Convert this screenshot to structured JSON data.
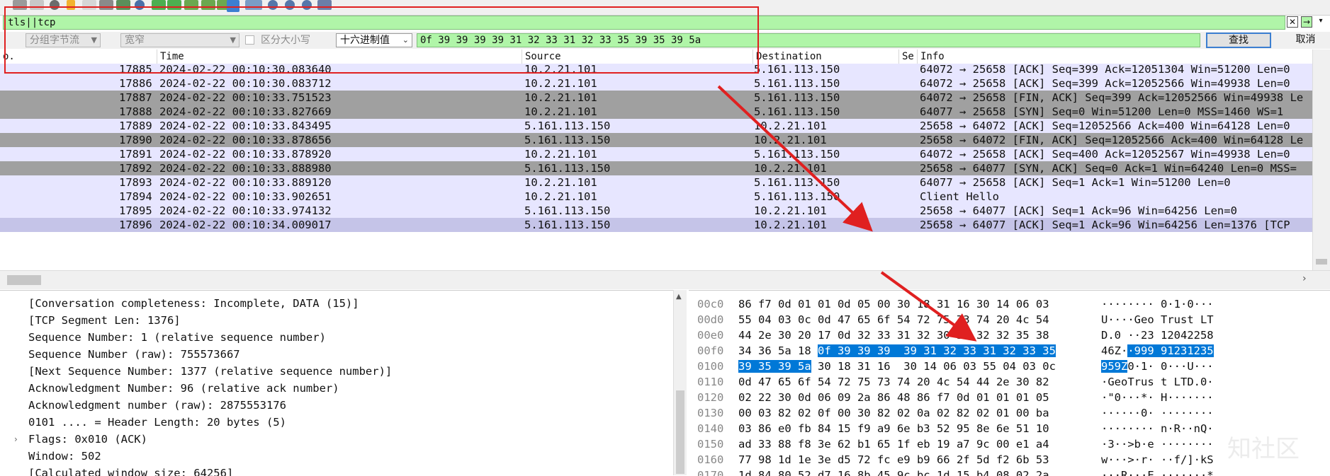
{
  "filter": {
    "value": "tls||tcp"
  },
  "find": {
    "search_type": "分组字节流",
    "charset": "宽窄",
    "case_label": "区分大小写",
    "display_type": "十六进制值",
    "value": "0f 39 39 39 39 31 32 33 31 32 33 35 39 35 39 5a",
    "find_button": "查找",
    "cancel_button": "取消"
  },
  "columns": {
    "no": "o.",
    "time": "Time",
    "source": "Source",
    "destination": "Destination",
    "se": "Se",
    "info": "Info"
  },
  "packets": [
    {
      "no": "17885",
      "time": "2024-02-22 00:10:30.083640",
      "src": "10.2.21.101",
      "dst": "5.161.113.150",
      "info": "64072 → 25658 [ACK] Seq=399 Ack=12051304 Win=51200 Len=0",
      "style": "tcp"
    },
    {
      "no": "17886",
      "time": "2024-02-22 00:10:30.083712",
      "src": "10.2.21.101",
      "dst": "5.161.113.150",
      "info": "64072 → 25658 [ACK] Seq=399 Ack=12052566 Win=49938 Len=0",
      "style": "tcp"
    },
    {
      "no": "17887",
      "time": "2024-02-22 00:10:33.751523",
      "src": "10.2.21.101",
      "dst": "5.161.113.150",
      "info": "64072 → 25658 [FIN, ACK] Seq=399 Ack=12052566 Win=49938 Le",
      "style": "dark"
    },
    {
      "no": "17888",
      "time": "2024-02-22 00:10:33.827669",
      "src": "10.2.21.101",
      "dst": "5.161.113.150",
      "info": "64077 → 25658 [SYN] Seq=0 Win=51200 Len=0 MSS=1460 WS=1",
      "style": "dark"
    },
    {
      "no": "17889",
      "time": "2024-02-22 00:10:33.843495",
      "src": "5.161.113.150",
      "dst": "10.2.21.101",
      "info": "25658 → 64072 [ACK] Seq=12052566 Ack=400 Win=64128 Len=0",
      "style": "tcp"
    },
    {
      "no": "17890",
      "time": "2024-02-22 00:10:33.878656",
      "src": "5.161.113.150",
      "dst": "10.2.21.101",
      "info": "25658 → 64072 [FIN, ACK] Seq=12052566 Ack=400 Win=64128 Le",
      "style": "dark"
    },
    {
      "no": "17891",
      "time": "2024-02-22 00:10:33.878920",
      "src": "10.2.21.101",
      "dst": "5.161.113.150",
      "info": "64072 → 25658 [ACK] Seq=400 Ack=12052567 Win=49938 Len=0",
      "style": "tcp"
    },
    {
      "no": "17892",
      "time": "2024-02-22 00:10:33.888980",
      "src": "5.161.113.150",
      "dst": "10.2.21.101",
      "info": "25658 → 64077 [SYN, ACK] Seq=0 Ack=1 Win=64240 Len=0 MSS=",
      "style": "dark"
    },
    {
      "no": "17893",
      "time": "2024-02-22 00:10:33.889120",
      "src": "10.2.21.101",
      "dst": "5.161.113.150",
      "info": "64077 → 25658 [ACK] Seq=1 Ack=1 Win=51200 Len=0",
      "style": "tcp"
    },
    {
      "no": "17894",
      "time": "2024-02-22 00:10:33.902651",
      "src": "10.2.21.101",
      "dst": "5.161.113.150",
      "info": "Client Hello",
      "style": "tcp"
    },
    {
      "no": "17895",
      "time": "2024-02-22 00:10:33.974132",
      "src": "5.161.113.150",
      "dst": "10.2.21.101",
      "info": "25658 → 64077 [ACK] Seq=1 Ack=96 Win=64256 Len=0",
      "style": "tcp"
    },
    {
      "no": "17896",
      "time": "2024-02-22 00:10:34.009017",
      "src": "5.161.113.150",
      "dst": "10.2.21.101",
      "info": "25658 → 64077 [ACK] Seq=1 Ack=96 Win=64256 Len=1376 [TCP",
      "style": "selected"
    }
  ],
  "details": [
    "[Conversation completeness: Incomplete, DATA (15)]",
    "[TCP Segment Len: 1376]",
    "Sequence Number: 1    (relative sequence number)",
    "Sequence Number (raw): 755573667",
    "[Next Sequence Number: 1377    (relative sequence number)]",
    "Acknowledgment Number: 96    (relative ack number)",
    "Acknowledgment number (raw): 2875553176",
    "0101 .... = Header Length: 20 bytes (5)",
    "Flags: 0x010 (ACK)",
    "Window: 502",
    "[Calculated window size: 64256]"
  ],
  "hex": [
    {
      "off": "00c0",
      "pre": "86 f7 0d 01 01 0d 05 00  30 18 31 16 30 14 06 03",
      "hl": "",
      "post": "",
      "apre": "········ 0·1·0···",
      "ahl": "",
      "apost": ""
    },
    {
      "off": "00d0",
      "pre": "55 04 03 0c 0d 47 65 6f  54 72 75 73 74 20 4c 54",
      "hl": "",
      "post": "",
      "apre": "U····Geo Trust LT",
      "ahl": "",
      "apost": ""
    },
    {
      "off": "00e0",
      "pre": "44 2e 30 20 17 0d 32 33  31 32 30 34 32 32 35 38",
      "hl": "",
      "post": "",
      "apre": "D.0 ··23 12042258",
      "ahl": "",
      "apost": ""
    },
    {
      "off": "00f0",
      "pre": "34 36 5a 18 ",
      "hl": "0f 39 39 39  39 31 32 33 31 32 33 35",
      "post": "",
      "apre": "46Z·",
      "ahl": "·999 91231235",
      "apost": ""
    },
    {
      "off": "0100",
      "pre": "",
      "hl": "39 35 39 5a",
      "post": " 30 18 31 16  30 14 06 03 55 04 03 0c",
      "apre": "",
      "ahl": "959Z",
      "apost": "0·1· 0···U···"
    },
    {
      "off": "0110",
      "pre": "0d 47 65 6f 54 72 75 73  74 20 4c 54 44 2e 30 82",
      "hl": "",
      "post": "",
      "apre": "·GeoTrus t LTD.0·",
      "ahl": "",
      "apost": ""
    },
    {
      "off": "0120",
      "pre": "02 22 30 0d 06 09 2a 86  48 86 f7 0d 01 01 01 05",
      "hl": "",
      "post": "",
      "apre": "·\"0···*· H·······",
      "ahl": "",
      "apost": ""
    },
    {
      "off": "0130",
      "pre": "00 03 82 02 0f 00 30 82  02 0a 02 82 02 01 00 ba",
      "hl": "",
      "post": "",
      "apre": "······0· ········",
      "ahl": "",
      "apost": ""
    },
    {
      "off": "0140",
      "pre": "03 86 e0 fb 84 15 f9 a9  6e b3 52 95 8e 6e 51 10",
      "hl": "",
      "post": "",
      "apre": "········ n·R··nQ·",
      "ahl": "",
      "apost": ""
    },
    {
      "off": "0150",
      "pre": "ad 33 88 f8 3e 62 b1 65  1f eb 19 a7 9c 00 e1 a4",
      "hl": "",
      "post": "",
      "apre": "·3··>b·e ········",
      "ahl": "",
      "apost": ""
    },
    {
      "off": "0160",
      "pre": "77 98 1d 1e 3e d5 72 fc  e9 b9 66 2f 5d f2 6b 53",
      "hl": "",
      "post": "",
      "apre": "w···>·r· ··f/]·kS",
      "ahl": "",
      "apost": ""
    },
    {
      "off": "0170",
      "pre": "1d 84 80 52 d7 16 8b 45  9c bc 1d 15 b4 08 02 2a",
      "hl": "",
      "post": "",
      "apre": "···R···E ·······*",
      "ahl": "",
      "apost": ""
    }
  ],
  "watermark": "知社区",
  "colors": {
    "tcp_row": "#e7e6ff",
    "dark_row": "#a0a0a0",
    "selected_row": "#c5c4e8",
    "filter_green": "#b0f5a8",
    "highlight": "#0078d7",
    "annotation_red": "#e02020"
  }
}
